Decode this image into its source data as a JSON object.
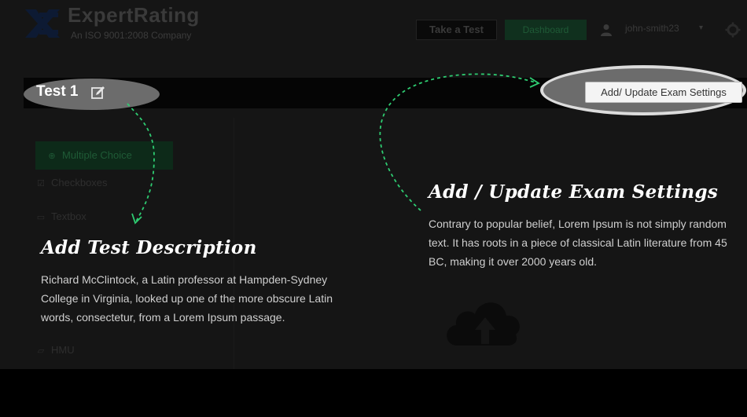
{
  "header": {
    "logo_text": "ExpertRating",
    "logo_subtitle": "An ISO 9001:2008 Company",
    "take_test_label": "Take a Test",
    "green_button_label": "Dashboard",
    "username": "john-smith23",
    "caret": "▾"
  },
  "test": {
    "title": "Test 1",
    "settings_button_label": "Add/ Update Exam Settings"
  },
  "sidebar": {
    "items": [
      {
        "label": "Multiple Choice",
        "icon": "plus-icon"
      },
      {
        "label": "Checkboxes",
        "icon": "checkbox-icon"
      },
      {
        "label": "Textbox",
        "icon": "textbox-icon"
      },
      {
        "label": "HMU",
        "icon": "message-icon"
      }
    ]
  },
  "hints": {
    "description": {
      "heading": "Add Test Description",
      "body": "Richard McClintock, a Latin professor at Hampden-Sydney College in Virginia, looked up one of the more obscure Latin words, consectetur, from a Lorem Ipsum passage."
    },
    "settings": {
      "heading": "Add / Update Exam Settings",
      "body": "Contrary to popular belief, Lorem Ipsum is not simply random text. It has roots in a piece of classical Latin literature from 45 BC, making it over 2000 years old."
    }
  },
  "colors": {
    "overlay_bg": "#151515",
    "accent_green": "#2ecc71",
    "highlight": "#6c6c6c"
  }
}
